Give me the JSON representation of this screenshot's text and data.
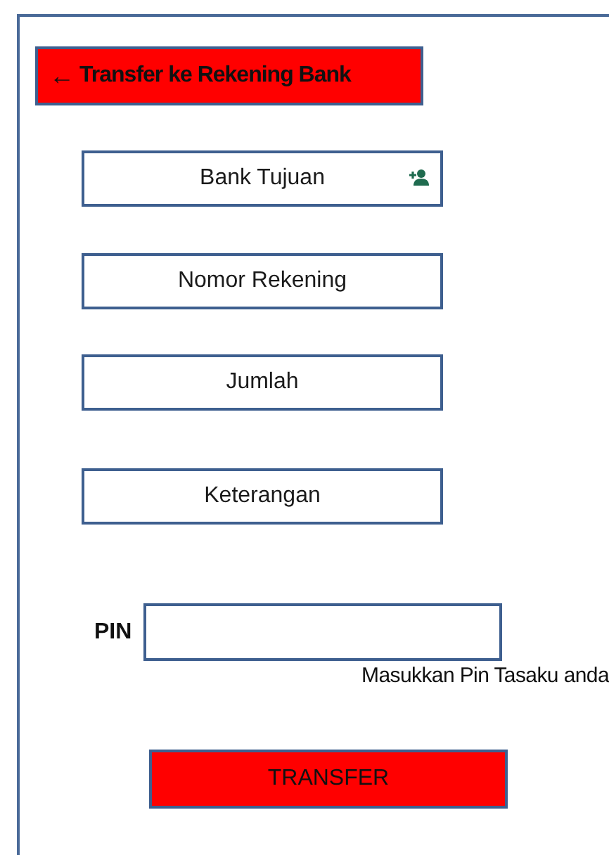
{
  "header": {
    "back_icon": "←",
    "title": "Transfer ke Rekening Bank"
  },
  "fields": [
    {
      "kind": "picker",
      "placeholder": "Bank Tujuan"
    },
    {
      "kind": "text",
      "placeholder": "Nomor Rekening"
    },
    {
      "kind": "text",
      "placeholder": "Jumlah"
    },
    {
      "kind": "text",
      "placeholder": "Keterangan"
    }
  ],
  "pin": {
    "label": "PIN",
    "hint": "Masukkan Pin Tasaku anda"
  },
  "submit": {
    "label": "TRANSFER"
  }
}
